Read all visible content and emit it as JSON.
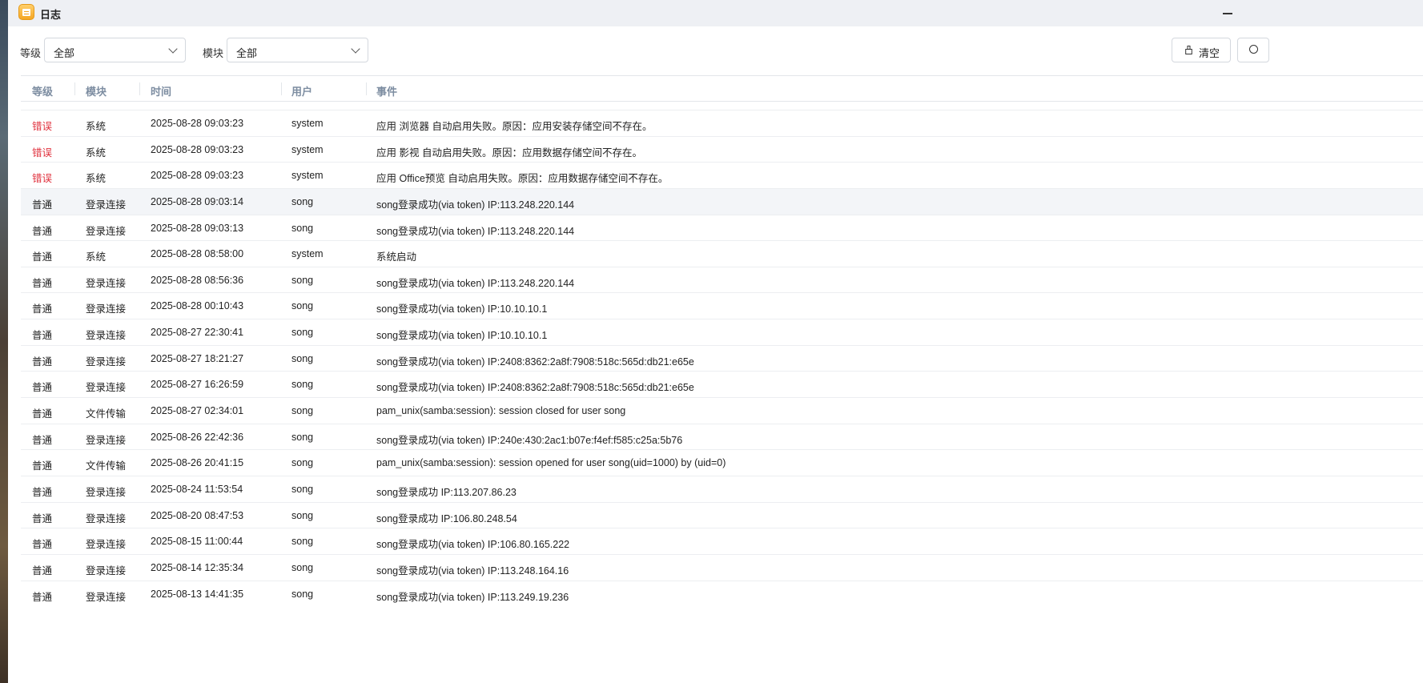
{
  "window": {
    "title": "日志"
  },
  "filters": {
    "level_label": "等级",
    "level_value": "全部",
    "module_label": "模块",
    "module_value": "全部"
  },
  "toolbar": {
    "clear_label": "清空"
  },
  "table": {
    "headers": {
      "level": "等级",
      "module": "模块",
      "time": "时间",
      "user": "用户",
      "event": "事件"
    },
    "rows": [
      {
        "level": "错误",
        "severity": "error",
        "module": "系统",
        "time": "2025-08-28 09:03:23",
        "user": "system",
        "event": "应用 浏览器 自动启用失败。原因：应用安装存储空间不存在。"
      },
      {
        "level": "错误",
        "severity": "error",
        "module": "系统",
        "time": "2025-08-28 09:03:23",
        "user": "system",
        "event": "应用 影视 自动启用失败。原因：应用数据存储空间不存在。"
      },
      {
        "level": "错误",
        "severity": "error",
        "module": "系统",
        "time": "2025-08-28 09:03:23",
        "user": "system",
        "event": "应用 Office预览 自动启用失败。原因：应用数据存储空间不存在。"
      },
      {
        "level": "普通",
        "severity": "normal",
        "module": "登录连接",
        "time": "2025-08-28 09:03:14",
        "user": "song",
        "event": "song登录成功(via token) IP:113.248.220.144"
      },
      {
        "level": "普通",
        "severity": "normal",
        "module": "登录连接",
        "time": "2025-08-28 09:03:13",
        "user": "song",
        "event": "song登录成功(via token) IP:113.248.220.144"
      },
      {
        "level": "普通",
        "severity": "normal",
        "module": "系统",
        "time": "2025-08-28 08:58:00",
        "user": "system",
        "event": "系统启动"
      },
      {
        "level": "普通",
        "severity": "normal",
        "module": "登录连接",
        "time": "2025-08-28 08:56:36",
        "user": "song",
        "event": "song登录成功(via token) IP:113.248.220.144"
      },
      {
        "level": "普通",
        "severity": "normal",
        "module": "登录连接",
        "time": "2025-08-28 00:10:43",
        "user": "song",
        "event": "song登录成功(via token) IP:10.10.10.1"
      },
      {
        "level": "普通",
        "severity": "normal",
        "module": "登录连接",
        "time": "2025-08-27 22:30:41",
        "user": "song",
        "event": "song登录成功(via token) IP:10.10.10.1"
      },
      {
        "level": "普通",
        "severity": "normal",
        "module": "登录连接",
        "time": "2025-08-27 18:21:27",
        "user": "song",
        "event": "song登录成功(via token) IP:2408:8362:2a8f:7908:518c:565d:db21:e65e"
      },
      {
        "level": "普通",
        "severity": "normal",
        "module": "登录连接",
        "time": "2025-08-27 16:26:59",
        "user": "song",
        "event": "song登录成功(via token) IP:2408:8362:2a8f:7908:518c:565d:db21:e65e"
      },
      {
        "level": "普通",
        "severity": "normal",
        "module": "文件传输",
        "time": "2025-08-27 02:34:01",
        "user": "song",
        "event": "pam_unix(samba:session): session closed for user song"
      },
      {
        "level": "普通",
        "severity": "normal",
        "module": "登录连接",
        "time": "2025-08-26 22:42:36",
        "user": "song",
        "event": "song登录成功(via token) IP:240e:430:2ac1:b07e:f4ef:f585:c25a:5b76"
      },
      {
        "level": "普通",
        "severity": "normal",
        "module": "文件传输",
        "time": "2025-08-26 20:41:15",
        "user": "song",
        "event": "pam_unix(samba:session): session opened for user song(uid=1000) by (uid=0)"
      },
      {
        "level": "普通",
        "severity": "normal",
        "module": "登录连接",
        "time": "2025-08-24 11:53:54",
        "user": "song",
        "event": "song登录成功 IP:113.207.86.23"
      },
      {
        "level": "普通",
        "severity": "normal",
        "module": "登录连接",
        "time": "2025-08-20 08:47:53",
        "user": "song",
        "event": "song登录成功 IP:106.80.248.54"
      },
      {
        "level": "普通",
        "severity": "normal",
        "module": "登录连接",
        "time": "2025-08-15 11:00:44",
        "user": "song",
        "event": "song登录成功(via token) IP:106.80.165.222"
      },
      {
        "level": "普通",
        "severity": "normal",
        "module": "登录连接",
        "time": "2025-08-14 12:35:34",
        "user": "song",
        "event": "song登录成功(via token) IP:113.248.164.16"
      },
      {
        "level": "普通",
        "severity": "normal",
        "module": "登录连接",
        "time": "2025-08-13 14:41:35",
        "user": "song",
        "event": "song登录成功(via token) IP:113.249.19.236"
      }
    ]
  },
  "colors": {
    "error_level": "#e0323e",
    "header_text": "#7d8da1",
    "accent_icon": "#f5a623"
  }
}
